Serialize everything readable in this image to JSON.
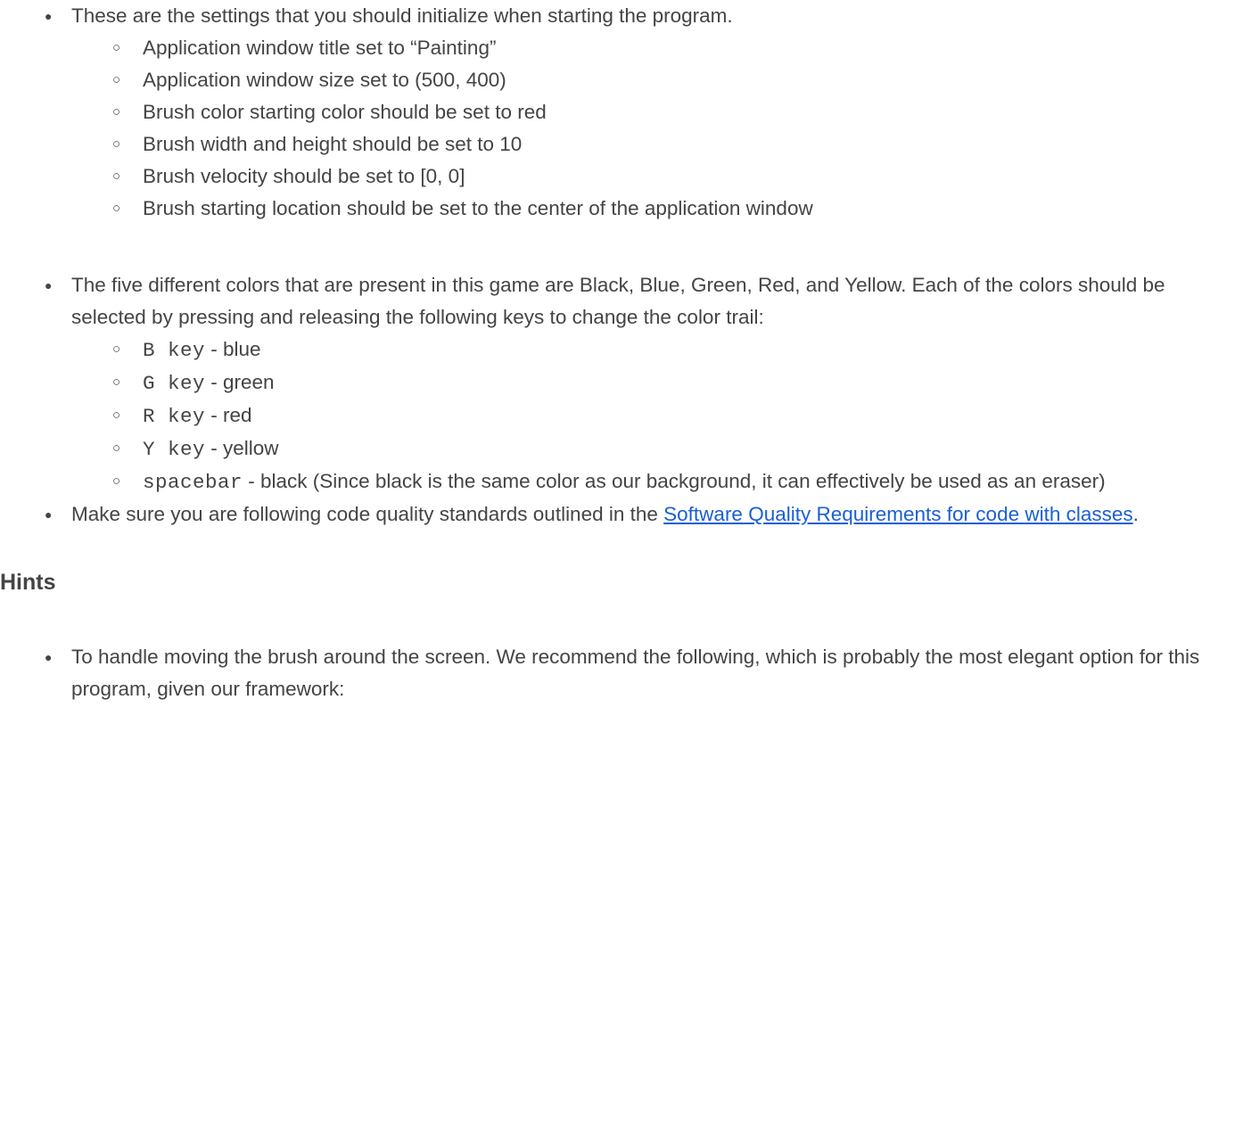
{
  "section1": {
    "intro": "These are the settings that you should initialize when starting the program.",
    "items": [
      "Application window title set to “Painting”",
      "Application window size set to (500, 400)",
      "Brush color starting color should be set to red",
      "Brush width and height should be set to 10",
      "Brush velocity should be set to [0, 0]",
      "Brush starting location should be set to the center of the application window"
    ]
  },
  "section2": {
    "intro": "The five different colors that are present in this game are Black, Blue, Green, Red, and Yellow. Each of the colors should be selected by pressing and releasing the following keys to change the color trail:",
    "keys": [
      {
        "code": "B key",
        "rest": " - blue"
      },
      {
        "code": "G key",
        "rest": " - green"
      },
      {
        "code": "R key",
        "rest": " - red"
      },
      {
        "code": "Y key",
        "rest": " - yellow"
      },
      {
        "code": "spacebar",
        "rest": " - black (Since black is the same color as our background, it can effectively be used as an eraser)"
      }
    ]
  },
  "section3": {
    "pre": "Make sure you are following code quality standards outlined in the ",
    "link": "Software Quality Requirements for code with classes",
    "post": "."
  },
  "hints": {
    "heading": "Hints",
    "item1": "To handle moving the brush around the screen. We recommend the following, which is probably the most elegant option for this program, given our framework:"
  }
}
